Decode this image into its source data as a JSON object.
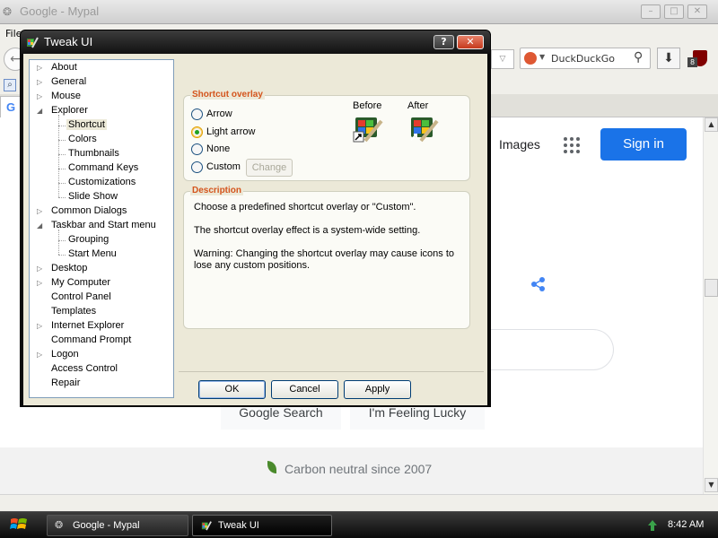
{
  "browser": {
    "title": "Google - Mypal",
    "menu_file": "File",
    "search_placeholder": "DuckDuckGo"
  },
  "google_page": {
    "images_link": "Images",
    "signin_label": "Sign in",
    "search_button": "Google Search",
    "lucky_button": "I'm Feeling Lucky",
    "footer_text": "Carbon neutral since 2007"
  },
  "dialog": {
    "title": "Tweak UI",
    "help_label": "?",
    "close_label": "✕",
    "tree": [
      {
        "label": "About",
        "expander": "▷",
        "level": 0
      },
      {
        "label": "General",
        "expander": "▷",
        "level": 0
      },
      {
        "label": "Mouse",
        "expander": "▷",
        "level": 0
      },
      {
        "label": "Explorer",
        "expander": "◢",
        "level": 0
      },
      {
        "label": "Shortcut",
        "expander": "",
        "level": 1,
        "selected": true
      },
      {
        "label": "Colors",
        "expander": "",
        "level": 1
      },
      {
        "label": "Thumbnails",
        "expander": "",
        "level": 1
      },
      {
        "label": "Command Keys",
        "expander": "",
        "level": 1
      },
      {
        "label": "Customizations",
        "expander": "",
        "level": 1
      },
      {
        "label": "Slide Show",
        "expander": "",
        "level": 1
      },
      {
        "label": "Common Dialogs",
        "expander": "▷",
        "level": 0
      },
      {
        "label": "Taskbar and Start menu",
        "expander": "◢",
        "level": 0
      },
      {
        "label": "Grouping",
        "expander": "",
        "level": 1
      },
      {
        "label": "Start Menu",
        "expander": "",
        "level": 1
      },
      {
        "label": "Desktop",
        "expander": "▷",
        "level": 0
      },
      {
        "label": "My Computer",
        "expander": "▷",
        "level": 0
      },
      {
        "label": "Control Panel",
        "expander": "",
        "level": 0
      },
      {
        "label": "Templates",
        "expander": "",
        "level": 0
      },
      {
        "label": "Internet Explorer",
        "expander": "▷",
        "level": 0
      },
      {
        "label": "Command Prompt",
        "expander": "",
        "level": 0
      },
      {
        "label": "Logon",
        "expander": "▷",
        "level": 0
      },
      {
        "label": "Access Control",
        "expander": "",
        "level": 0
      },
      {
        "label": "Repair",
        "expander": "",
        "level": 0
      }
    ],
    "shortcut_group": {
      "title": "Shortcut overlay",
      "options": [
        "Arrow",
        "Light arrow",
        "None",
        "Custom"
      ],
      "selected": "Light arrow",
      "change_button": "Change",
      "before_label": "Before",
      "after_label": "After"
    },
    "description_group": {
      "title": "Description",
      "line1": "Choose a predefined shortcut overlay or \"Custom\".",
      "line2": "The shortcut overlay effect is a system-wide setting.",
      "line3": "Warning: Changing the shortcut overlay may cause icons to lose any custom positions."
    },
    "buttons": {
      "ok": "OK",
      "cancel": "Cancel",
      "apply": "Apply"
    }
  },
  "taskbar": {
    "tasks": [
      {
        "label": "Google - Mypal"
      },
      {
        "label": "Tweak UI"
      }
    ],
    "clock": "8:42 AM"
  },
  "colors": {
    "accent_orange": "#d4541c",
    "signin_blue": "#1a73e8",
    "dialog_face": "#ece9d8"
  }
}
